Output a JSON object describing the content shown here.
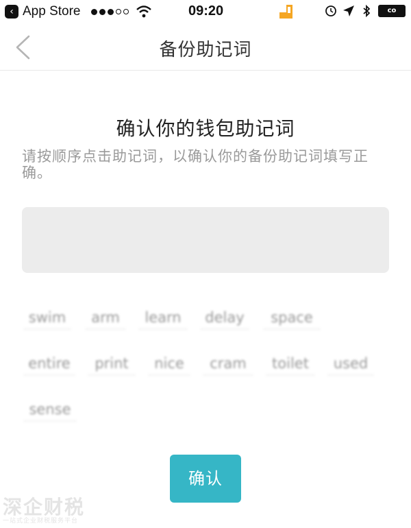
{
  "status_bar": {
    "back_badge": "‹",
    "app_label": "App Store",
    "time": "09:20",
    "battery_label": "co",
    "icons": [
      "back-badge-icon",
      "signal-dots-icon",
      "wifi-icon",
      "orange-app-icon",
      "alarm-icon",
      "location-arrow-icon",
      "bluetooth-icon",
      "battery-icon"
    ]
  },
  "nav": {
    "title": "备份助记词",
    "back_icon": "chevron-left-icon"
  },
  "main": {
    "heading": "确认你的钱包助记词",
    "instructions": "请按顺序点击助记词，以确认你的备份助记词填写正确。",
    "words": [
      "swim",
      "arm",
      "learn",
      "delay",
      "space",
      "entire",
      "print",
      "nice",
      "cram",
      "toilet",
      "used",
      "sense"
    ],
    "confirm_label": "确认"
  },
  "watermark": {
    "main": "深企财税",
    "sub": "一站式企业财税服务平台"
  },
  "colors": {
    "accent": "#36b6c6",
    "selected_area": "#ececec",
    "instruction_text": "#9a9a9a"
  }
}
